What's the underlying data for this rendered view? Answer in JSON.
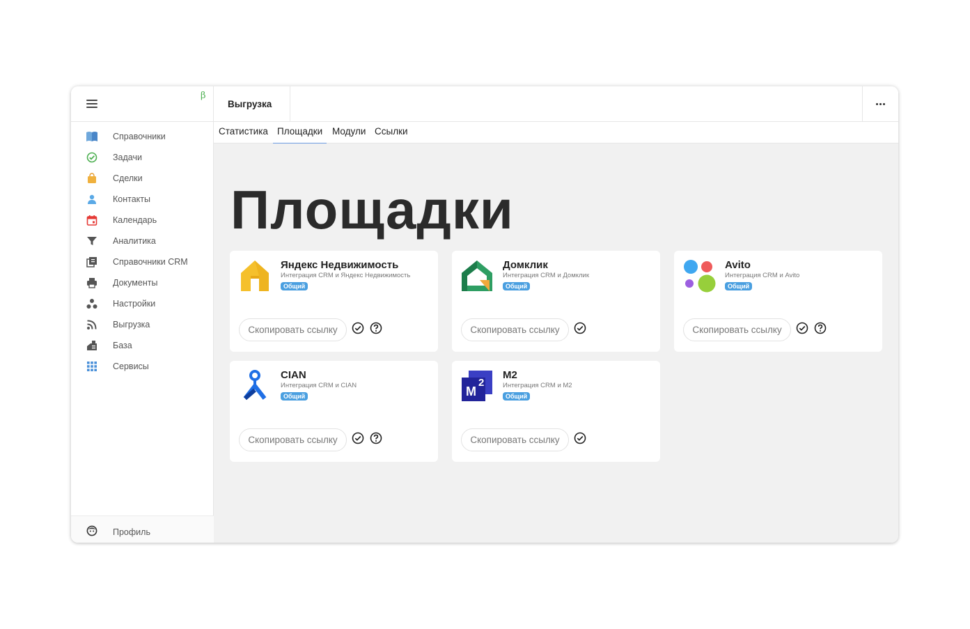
{
  "sidebar": {
    "beta": "β",
    "items": [
      {
        "label": "Справочники",
        "icon": "book-icon"
      },
      {
        "label": "Задачи",
        "icon": "check-circle-icon"
      },
      {
        "label": "Сделки",
        "icon": "bag-icon"
      },
      {
        "label": "Контакты",
        "icon": "person-icon"
      },
      {
        "label": "Календарь",
        "icon": "calendar-icon"
      },
      {
        "label": "Аналитика",
        "icon": "funnel-icon"
      },
      {
        "label": "Справочники CRM",
        "icon": "library-icon"
      },
      {
        "label": "Документы",
        "icon": "printer-icon"
      },
      {
        "label": "Настройки",
        "icon": "settings-dots-icon"
      },
      {
        "label": "Выгрузка",
        "icon": "rss-icon"
      },
      {
        "label": "База",
        "icon": "database-icon"
      },
      {
        "label": "Сервисы",
        "icon": "grid-icon"
      }
    ],
    "profile": {
      "label": "Профиль",
      "icon": "face-icon"
    }
  },
  "header": {
    "title": "Выгрузка"
  },
  "tabs": [
    {
      "label": "Статистика"
    },
    {
      "label": "Площадки",
      "active": true
    },
    {
      "label": "Модули"
    },
    {
      "label": "Ссылки"
    }
  ],
  "main": {
    "title": "Площадки",
    "cards": [
      {
        "name": "Яндекс Недвижимость",
        "subtitle": "Интеграция CRM и Яндекс Недвижимость",
        "badge": "Общий",
        "copy_label": "Скопировать ссылку",
        "logo": "yandex-realty-logo",
        "help": true
      },
      {
        "name": "Домклик",
        "subtitle": "Интеграция CRM и Домклик",
        "badge": "Общий",
        "copy_label": "Скопировать ссылку",
        "logo": "domclick-logo",
        "help": false
      },
      {
        "name": "Avito",
        "subtitle": "Интеграция CRM и Avito",
        "badge": "Общий",
        "copy_label": "Скопировать ссылку",
        "logo": "avito-logo",
        "help": true
      },
      {
        "name": "CIAN",
        "subtitle": "Интеграция CRM и CIAN",
        "badge": "Общий",
        "copy_label": "Скопировать ссылку",
        "logo": "cian-logo",
        "help": true
      },
      {
        "name": "M2",
        "subtitle": "Интеграция CRM и M2",
        "badge": "Общий",
        "copy_label": "Скопировать ссылку",
        "logo": "m2-logo",
        "logo_text": "M",
        "logo_sup": "2",
        "help": false
      }
    ]
  },
  "colors": {
    "accent": "#6b9be0",
    "badge": "#4a9fe0",
    "beta": "#4caf50",
    "main_bg": "#f1f1f1"
  }
}
